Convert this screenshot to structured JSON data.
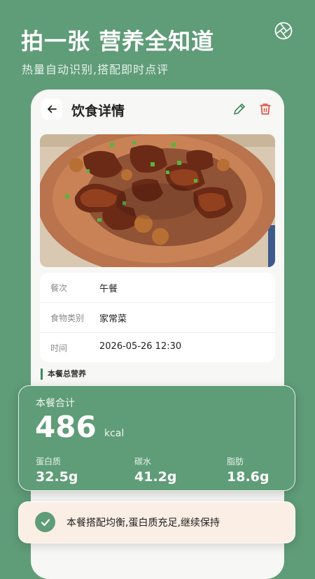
{
  "hero": {
    "title": "拍一张 营养全知道",
    "subtitle": "热量自动识别,搭配即时点评",
    "camera_icon": "aperture-icon"
  },
  "detail": {
    "title": "饮食详情",
    "back_icon": "arrow-left-icon",
    "edit_icon": "pencil-icon",
    "delete_icon": "trash-icon",
    "photo_alt": "红烧肉"
  },
  "info": {
    "rows": [
      {
        "label": "餐次",
        "value": "午餐"
      },
      {
        "label": "食物类别",
        "value": "家常菜"
      },
      {
        "label": "时间",
        "value": "2026-05-26 12:30"
      }
    ]
  },
  "section": {
    "title": "本餐总营养"
  },
  "nutrition": {
    "label": "本餐合计",
    "calories": "486",
    "unit": "kcal",
    "macros": [
      {
        "label": "蛋白质",
        "value": "32.5g"
      },
      {
        "label": "碳水",
        "value": "41.2g"
      },
      {
        "label": "脂肪",
        "value": "18.6g"
      }
    ]
  },
  "tip": {
    "text": "本餐搭配均衡,蛋白质充足,继续保持",
    "icon": "check-circle-icon"
  },
  "colors": {
    "brand_green": "#5f9c78",
    "delete_red": "#e0453a",
    "tip_bg": "#fbeee4"
  }
}
